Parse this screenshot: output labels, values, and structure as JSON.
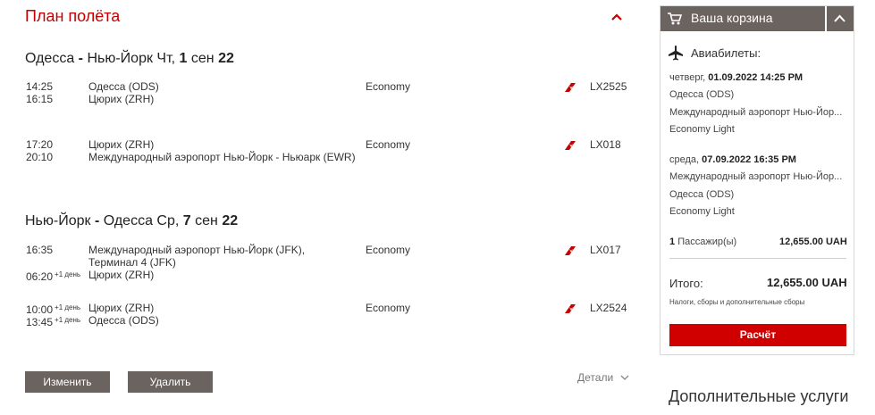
{
  "plan": {
    "title": "План полёта",
    "outbound": {
      "from": "Одесса",
      "sep": " - ",
      "to": "Нью-Йорк",
      "weekday": "Чт,",
      "day": "1",
      "month": "сен",
      "year": "22",
      "segments": [
        {
          "dep_time": "14:25",
          "arr_time": "16:15",
          "dep_airport": "Одесса (ODS)",
          "arr_airport": "Цюрих (ZRH)",
          "cabin": "Economy",
          "flight": "LX2525"
        },
        {
          "dep_time": "17:20",
          "arr_time": "20:10",
          "dep_airport": "Цюрих (ZRH)",
          "arr_airport": "Международный аэропорт Нью-Йорк - Ньюарк (EWR)",
          "cabin": "Economy",
          "flight": "LX018"
        }
      ]
    },
    "inbound": {
      "from": "Нью-Йорк",
      "sep": " - ",
      "to": "Одесса",
      "weekday": "Ср,",
      "day": "7",
      "month": "сен",
      "year": "22",
      "segments": [
        {
          "dep_time": "16:35",
          "arr_time": "06:20",
          "arr_plus": "+1 день",
          "dep_airport": "Международный аэропорт Нью-Йорк (JFK),",
          "dep_airport_line2": "Терминал 4 (JFK)",
          "arr_airport": "Цюрих (ZRH)",
          "cabin": "Economy",
          "flight": "LX017"
        },
        {
          "dep_time": "10:00",
          "dep_plus": "+1 день",
          "arr_time": "13:45",
          "arr_plus": "+1 день",
          "dep_airport": "Цюрих (ZRH)",
          "arr_airport": "Одесса (ODS)",
          "cabin": "Economy",
          "flight": "LX2524"
        }
      ]
    },
    "buttons": {
      "change": "Изменить",
      "delete": "Удалить"
    },
    "details_label": "Детали"
  },
  "cart": {
    "title": "Ваша корзина",
    "section_title": "Авиабилеты:",
    "flights": [
      {
        "date_prefix": "четверг, ",
        "date": "01.09.2022 14:25 PM",
        "line1": "Одесса (ODS)",
        "line2": "Международный аэропорт Нью-Йор...",
        "fare": "Economy Light"
      },
      {
        "date_prefix": "среда, ",
        "date": "07.09.2022 16:35 PM",
        "line1": "Международный аэропорт Нью-Йор...",
        "line2": "Одесса (ODS)",
        "fare": "Economy Light"
      }
    ],
    "passengers_count": "1",
    "passengers_label": "Пассажир(ы)",
    "passengers_price": "12,655.00 UAH",
    "total_label": "Итого:",
    "total_price": "12,655.00 UAH",
    "taxes_note": "Налоги, сборы и дополнительные сборы",
    "checkout_button": "Расчёт"
  },
  "extra_services_title": "Дополнительные услуги",
  "colors": {
    "brand_red": "#c40000",
    "header_gray": "#6b6360",
    "checkout_red": "#d10000"
  }
}
